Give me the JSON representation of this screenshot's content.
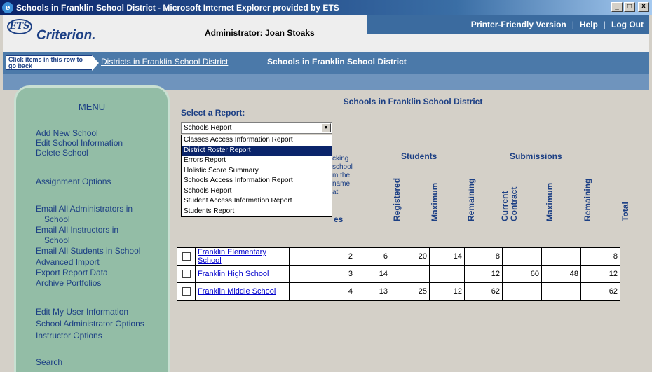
{
  "window": {
    "title": "Schools in Franklin School District - Microsoft Internet Explorer provided by ETS",
    "controls": {
      "minimize": "_",
      "maximize": "□",
      "close": "X"
    }
  },
  "header": {
    "logo_ets": "ETS",
    "logo_product": "Criterion.",
    "administrator": "Administrator: Joan Stoaks",
    "links": {
      "printer": "Printer-Friendly Version",
      "help": "Help",
      "logout": "Log Out",
      "separator": "|"
    }
  },
  "breadcrumb": {
    "hint": "Click items in this row to go back",
    "district_link": "Districts in Franklin School District",
    "current": "Schools in Franklin School District"
  },
  "menu": {
    "title": "MENU",
    "items": [
      "Add New School",
      "Edit School Information",
      "Delete School",
      "Assignment Options",
      "Email All Administrators in",
      "School",
      "Email All Instructors in",
      "School",
      "Email All Students in School",
      "Advanced Import",
      "Export Report Data",
      "Archive Portfolios",
      "Edit My User Information",
      "School Administrator Options",
      "Instructor Options",
      "Search"
    ]
  },
  "content": {
    "page_title": "Schools in Franklin School District",
    "select_label": "Select a Report:",
    "select_value": "Schools Report",
    "dropdown_options": [
      "Classes Access Information Report",
      "District Roster Report",
      "Errors Report",
      "Holistic Score Summary",
      "Schools Access Information Report",
      "Schools Report",
      "Student Access Information Report",
      "Students Report"
    ],
    "dropdown_selected_index": 1,
    "partial_text": [
      "cking",
      "school",
      "m the",
      "name",
      "at"
    ],
    "partial_link": "es",
    "groups": {
      "students": "Students",
      "submissions": "Submissions"
    },
    "columns": [
      "Registered",
      "Maximum",
      "Remaining",
      "Current Contract",
      "Maximum",
      "Remaining",
      "Total"
    ]
  },
  "table": {
    "rows": [
      {
        "name": "Franklin Elementary School",
        "c1": "2",
        "registered": "6",
        "maximum": "20",
        "remaining": "14",
        "current": "8",
        "sub_max": "",
        "sub_rem": "",
        "total": "8"
      },
      {
        "name": "Franklin High School",
        "c1": "3",
        "registered": "14",
        "maximum": "",
        "remaining": "",
        "current": "12",
        "sub_max": "60",
        "sub_rem": "48",
        "total": "12"
      },
      {
        "name": "Franklin Middle School",
        "c1": "4",
        "registered": "13",
        "maximum": "25",
        "remaining": "12",
        "current": "62",
        "sub_max": "",
        "sub_rem": "",
        "total": "62"
      }
    ]
  },
  "colors": {
    "title_bar": "#0a246a",
    "navy_text": "#1c3f84",
    "menu_bg": "#93bda6",
    "breadcrumb_bg": "#4b79a9",
    "selection": "#0a246a"
  }
}
